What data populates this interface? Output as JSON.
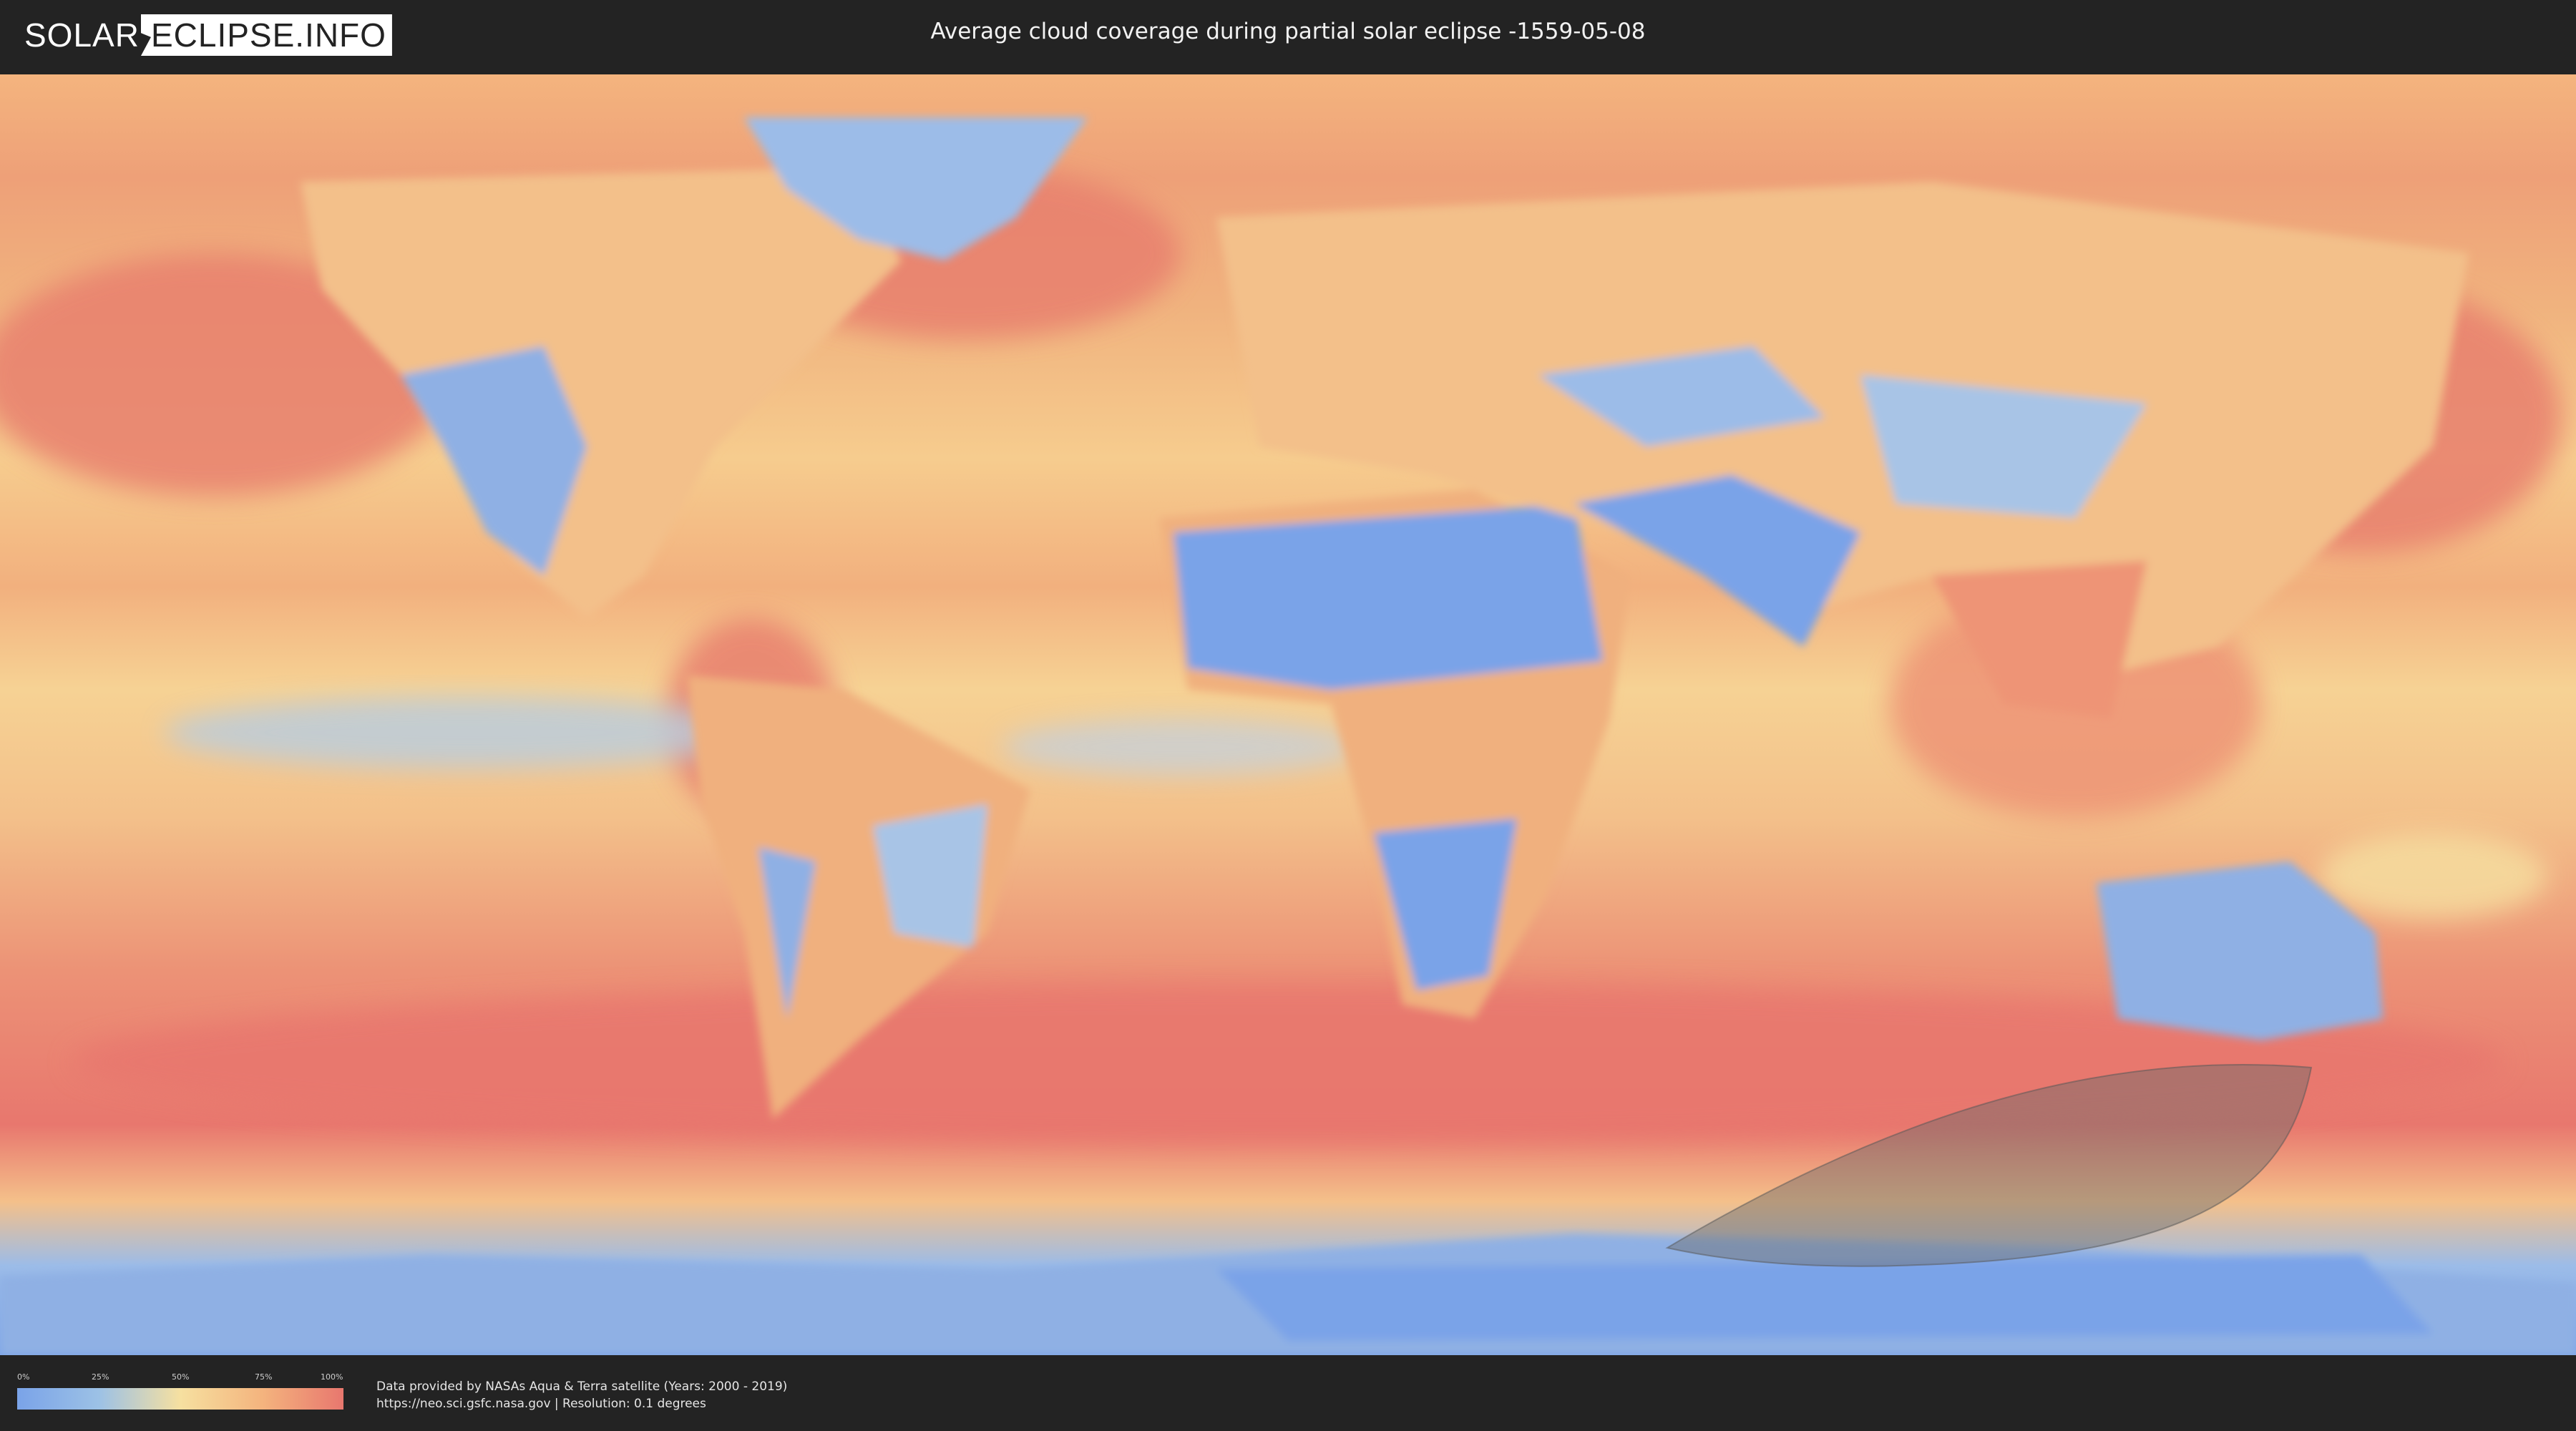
{
  "header": {
    "logo_left": "SOLAR",
    "logo_right": "ECLIPSE.INFO",
    "title": "Average cloud coverage during partial solar eclipse -1559-05-08"
  },
  "legend": {
    "ticks": [
      "0%",
      "25%",
      "50%",
      "75%",
      "100%"
    ],
    "colors": [
      "#7aa3e8",
      "#9cc1e6",
      "#f6e0a0",
      "#f4b47e",
      "#e8776e"
    ]
  },
  "credits": {
    "line1": "Data provided by NASAs Aqua & Terra satellite (Years: 2000 - 2019)",
    "line2": "https://neo.sci.gsfc.nasa.gov | Resolution: 0.1 degrees"
  },
  "map": {
    "projection": "equirectangular",
    "eclipse_zone_color": "#6b6b6b"
  }
}
